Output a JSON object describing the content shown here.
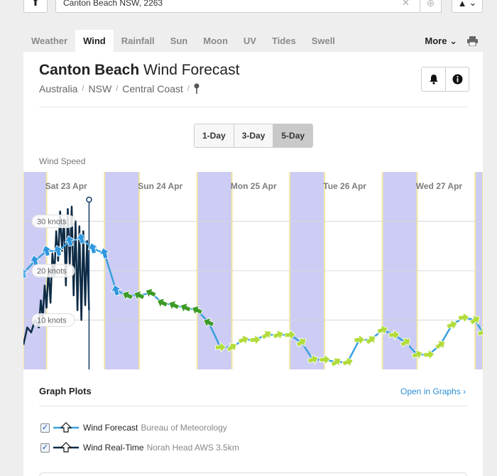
{
  "search": {
    "value": "Canton Beach NSW, 2263"
  },
  "tabs": [
    "Weather",
    "Wind",
    "Rainfall",
    "Sun",
    "Moon",
    "UV",
    "Tides",
    "Swell"
  ],
  "more_label": "More",
  "title": {
    "place": "Canton Beach",
    "suffix": "Wind Forecast"
  },
  "breadcrumb": [
    "Australia",
    "NSW",
    "Central Coast"
  ],
  "range_buttons": [
    "1-Day",
    "3-Day",
    "5-Day"
  ],
  "chart_label": "Wind Speed",
  "graph_plots": {
    "title": "Graph Plots",
    "link": "Open in Graphs",
    "items": [
      {
        "label": "Wind Forecast",
        "source": "Bureau of Meteorology",
        "color": "#3aa0dd"
      },
      {
        "label": "Wind Real-Time",
        "source": "Norah Head AWS 3.5km",
        "color": "#0d2b45"
      }
    ]
  },
  "chart_data": {
    "type": "line",
    "ylabel": "Wind Speed",
    "y_unit": "knots",
    "ylim": [
      0,
      40
    ],
    "y_ticks": [
      "10 knots",
      "20 knots",
      "30 knots"
    ],
    "y_tick_values": [
      10,
      20,
      30
    ],
    "day_labels": [
      "Sat 23 Apr",
      "Sun 24 Apr",
      "Mon 25 Apr",
      "Tue 26 Apr",
      "Wed 27 Apr"
    ],
    "x_range_hours": [
      -3,
      116
    ],
    "day_label_hours": [
      8,
      32,
      56,
      80,
      104
    ],
    "night_bands": [
      [
        -3,
        3
      ],
      [
        18,
        27
      ],
      [
        42,
        51
      ],
      [
        66,
        75
      ],
      [
        90,
        99
      ],
      [
        114,
        116
      ]
    ],
    "now_hour": 14,
    "series": [
      {
        "name": "Wind Forecast",
        "color": "#3aa0dd",
        "x": [
          -3,
          0,
          3,
          6,
          9,
          12,
          15,
          18,
          21,
          24,
          27,
          30,
          33,
          36,
          39,
          42,
          45,
          48,
          51,
          54,
          57,
          60,
          63,
          66,
          69,
          72,
          75,
          78,
          81,
          84,
          87,
          90,
          93,
          96,
          99,
          102,
          105,
          108,
          111,
          114,
          116
        ],
        "y": [
          19.5,
          22,
          24,
          24,
          26,
          26.5,
          24.5,
          23.5,
          16,
          15,
          15,
          15.5,
          13.5,
          13,
          12.5,
          12,
          9.5,
          4.5,
          4.5,
          6,
          6,
          7,
          7,
          7,
          5.5,
          2,
          2,
          1.5,
          1.5,
          6,
          6,
          8,
          7,
          5.5,
          3,
          3,
          5,
          9,
          10.5,
          10,
          7.5
        ],
        "arrows": [
          "g",
          "b",
          "b",
          "b",
          "b",
          "b",
          "b",
          "b",
          "b",
          "G",
          "G",
          "G",
          "G",
          "G",
          "G",
          "G",
          "G",
          "L",
          "L",
          "L",
          "L",
          "L",
          "L",
          "L",
          "L",
          "L",
          "L",
          "L",
          "L",
          "L",
          "L",
          "L",
          "L",
          "L",
          "L",
          "L",
          "L",
          "L",
          "L",
          "L",
          "L"
        ]
      },
      {
        "name": "Wind Real-Time",
        "color": "#0d2b45",
        "x": [
          -3,
          -2,
          -1,
          0,
          1,
          1.5,
          2,
          2.5,
          3,
          3.5,
          4,
          4.5,
          5,
          5.5,
          6,
          6.5,
          7,
          7.5,
          8,
          8.5,
          9,
          9.5,
          10,
          10.5,
          11,
          11.5,
          12,
          12.5,
          13,
          13.5,
          14
        ],
        "y": [
          5,
          8.5,
          7.5,
          10,
          8.5,
          14,
          10.5,
          17,
          12.5,
          20.5,
          13.5,
          23.5,
          19,
          28,
          22,
          32,
          24,
          30.5,
          17,
          32.5,
          21,
          33,
          15,
          30,
          12,
          29,
          10,
          28,
          13,
          26,
          12
        ]
      }
    ],
    "arrow_colors": {
      "b": "#2f97de",
      "G": "#3c9a26",
      "L": "#b2dc3b",
      "g": "#5ab0e6"
    }
  }
}
